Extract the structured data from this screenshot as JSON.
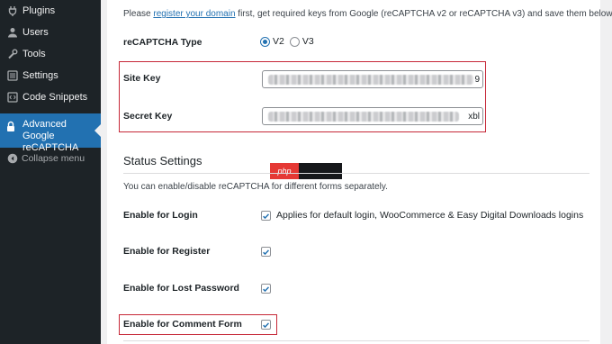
{
  "sidebar": {
    "items": [
      {
        "label": "Plugins",
        "icon": "plugin-icon"
      },
      {
        "label": "Users",
        "icon": "users-icon"
      },
      {
        "label": "Tools",
        "icon": "wrench-icon"
      },
      {
        "label": "Settings",
        "icon": "settings-icon"
      },
      {
        "label": "Code Snippets",
        "icon": "code-icon"
      }
    ],
    "active": {
      "line1": "Advanced Google",
      "line2": "reCAPTCHA",
      "icon": "lock-icon"
    },
    "collapse": {
      "label": "Collapse menu",
      "icon": "collapse-icon"
    }
  },
  "keys_section": {
    "intro_before": "Please ",
    "intro_link": "register your domain",
    "intro_after": " first, get required keys from Google (reCAPTCHA v2 or reCAPTCHA v3) and save them below.",
    "type_label": "reCAPTCHA Type",
    "type_options": [
      "V2",
      "V3"
    ],
    "type_selected": "V2",
    "site_key_label": "Site Key",
    "site_key_visible_tail": "9",
    "secret_key_label": "Secret Key",
    "secret_key_visible_tail": "xbl"
  },
  "status_section": {
    "title": "Status Settings",
    "description": "You can enable/disable reCAPTCHA for different forms separately.",
    "rows": [
      {
        "label": "Enable for Login",
        "checked": true,
        "note": "Applies for default login, WooCommerce & Easy Digital Downloads logins"
      },
      {
        "label": "Enable for Register",
        "checked": true,
        "note": ""
      },
      {
        "label": "Enable for Lost Password",
        "checked": true,
        "note": ""
      },
      {
        "label": "Enable for Comment Form",
        "checked": true,
        "note": ""
      }
    ]
  },
  "watermark": {
    "text": "php"
  },
  "colors": {
    "sidebar_bg": "#1d2327",
    "active_bg": "#2271b1",
    "highlight": "#c62838",
    "checkbox": "#2271b1"
  }
}
